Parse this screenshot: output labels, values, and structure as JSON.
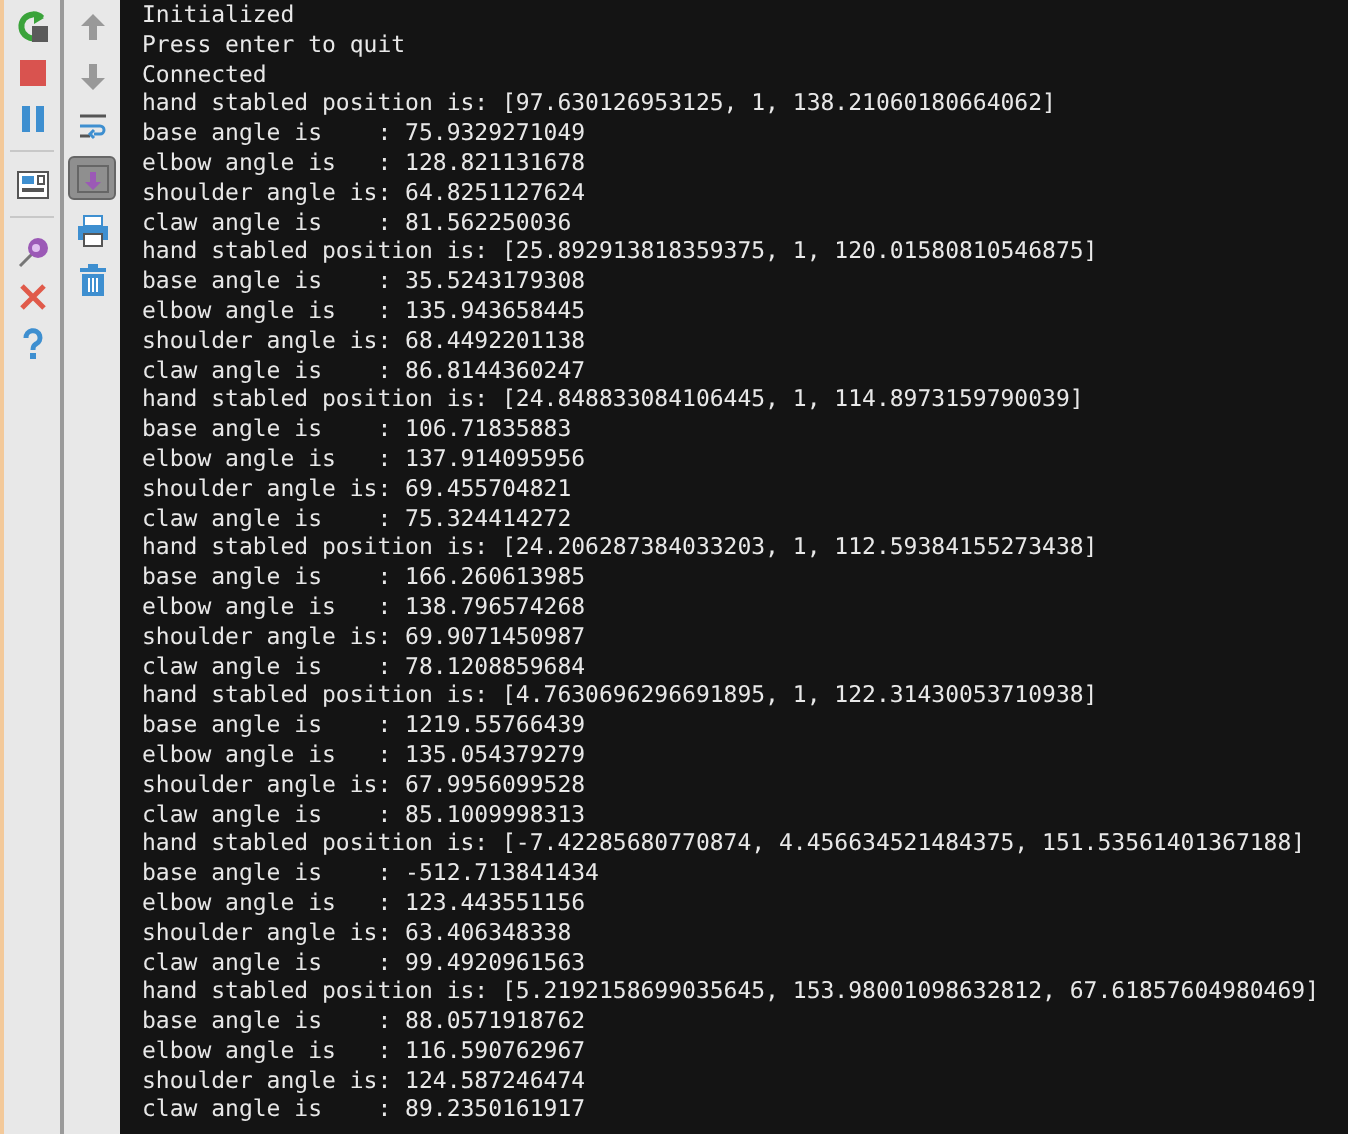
{
  "run_toolbar": [
    {
      "kind": "rerun",
      "selected": false
    },
    {
      "kind": "stop",
      "selected": false
    },
    {
      "kind": "pause",
      "selected": false
    },
    {
      "kind": "separator"
    },
    {
      "kind": "layout",
      "selected": false
    },
    {
      "kind": "separator"
    },
    {
      "kind": "pin",
      "selected": false
    },
    {
      "kind": "close",
      "selected": false
    },
    {
      "kind": "help",
      "selected": false
    }
  ],
  "console_toolbar": [
    {
      "kind": "up",
      "selected": false
    },
    {
      "kind": "down",
      "selected": false
    },
    {
      "kind": "wrap",
      "selected": false
    },
    {
      "kind": "scroll_end",
      "selected": true
    },
    {
      "kind": "print",
      "selected": false
    },
    {
      "kind": "trash",
      "selected": false
    }
  ],
  "console_lines": [
    "Initialized",
    "Press enter to quit",
    "Connected",
    "hand stabled position is: [97.630126953125, 1, 138.21060180664062]",
    "base angle is    : 75.9329271049",
    "elbow angle is   : 128.821131678",
    "shoulder angle is: 64.8251127624",
    "claw angle is    : 81.562250036",
    "hand stabled position is: [25.892913818359375, 1, 120.01580810546875]",
    "base angle is    : 35.5243179308",
    "elbow angle is   : 135.943658445",
    "shoulder angle is: 68.4492201138",
    "claw angle is    : 86.8144360247",
    "hand stabled position is: [24.848833084106445, 1, 114.8973159790039]",
    "base angle is    : 106.71835883",
    "elbow angle is   : 137.914095956",
    "shoulder angle is: 69.455704821",
    "claw angle is    : 75.324414272",
    "hand stabled position is: [24.206287384033203, 1, 112.59384155273438]",
    "base angle is    : 166.260613985",
    "elbow angle is   : 138.796574268",
    "shoulder angle is: 69.9071450987",
    "claw angle is    : 78.1208859684",
    "hand stabled position is: [4.7630696296691895, 1, 122.31430053710938]",
    "base angle is    : 1219.55766439",
    "elbow angle is   : 135.054379279",
    "shoulder angle is: 67.9956099528",
    "claw angle is    : 85.1009998313",
    "hand stabled position is: [-7.42285680770874, 4.456634521484375, 151.53561401367188]",
    "base angle is    : -512.713841434",
    "elbow angle is   : 123.443551156",
    "shoulder angle is: 63.406348338",
    "claw angle is    : 99.4920961563",
    "hand stabled position is: [5.2192158699035645, 153.98001098632812, 67.61857604980469]",
    "base angle is    : 88.0571918762",
    "elbow angle is   : 116.590762967",
    "shoulder angle is: 124.587246474",
    "claw angle is    : 89.2350161917"
  ]
}
